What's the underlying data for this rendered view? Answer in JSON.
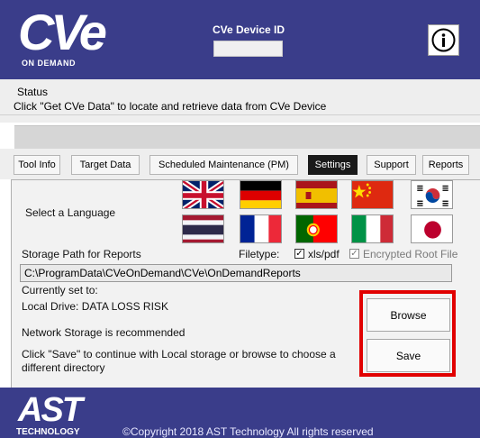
{
  "header": {
    "logo_text": "CVe",
    "logo_subtext": "ON DEMAND",
    "device_id_label": "CVe Device ID",
    "device_id_value": "",
    "info_icon": "info-icon"
  },
  "status": {
    "label": "Status",
    "message": "Click \"Get CVe Data\" to locate and retrieve data from CVe Device"
  },
  "tabs": [
    {
      "label": "Tool Info",
      "active": false
    },
    {
      "label": "Target Data",
      "active": false
    },
    {
      "label": "Scheduled Maintenance (PM)",
      "active": false
    },
    {
      "label": "Settings",
      "active": true
    },
    {
      "label": "Support",
      "active": false
    },
    {
      "label": "Reports",
      "active": false
    }
  ],
  "settings": {
    "language_label": "Select a Language",
    "languages": [
      "English (UK)",
      "German",
      "Spanish",
      "Chinese",
      "Korean",
      "Thai",
      "French",
      "Portuguese",
      "Italian",
      "Japanese"
    ],
    "storage_path_label": "Storage Path for Reports",
    "filetype_label": "Filetype:",
    "filetype_xls_pdf": {
      "label": "xls/pdf",
      "checked": true
    },
    "encrypted_root": {
      "label": "Encrypted Root File",
      "checked": true
    },
    "storage_path_value": "C:\\ProgramData\\CVeOnDemand\\CVe\\OnDemandReports",
    "currently_set_label": "Currently set to:",
    "local_drive_warning": "Local Drive: DATA LOSS RISK",
    "network_recommendation": "Network Storage is recommended",
    "save_instruction_line1": "Click \"Save\" to continue with Local storage or browse to choose a",
    "save_instruction_line2": "different directory",
    "browse_label": "Browse",
    "save_label": "Save"
  },
  "footer": {
    "logo_text": "AST",
    "logo_subtext": "TECHNOLOGY",
    "copyright": "©Copyright 2018 AST Technology   All rights reserved"
  },
  "colors": {
    "brand_navy": "#3a3d8a",
    "highlight_red": "#e10000"
  }
}
